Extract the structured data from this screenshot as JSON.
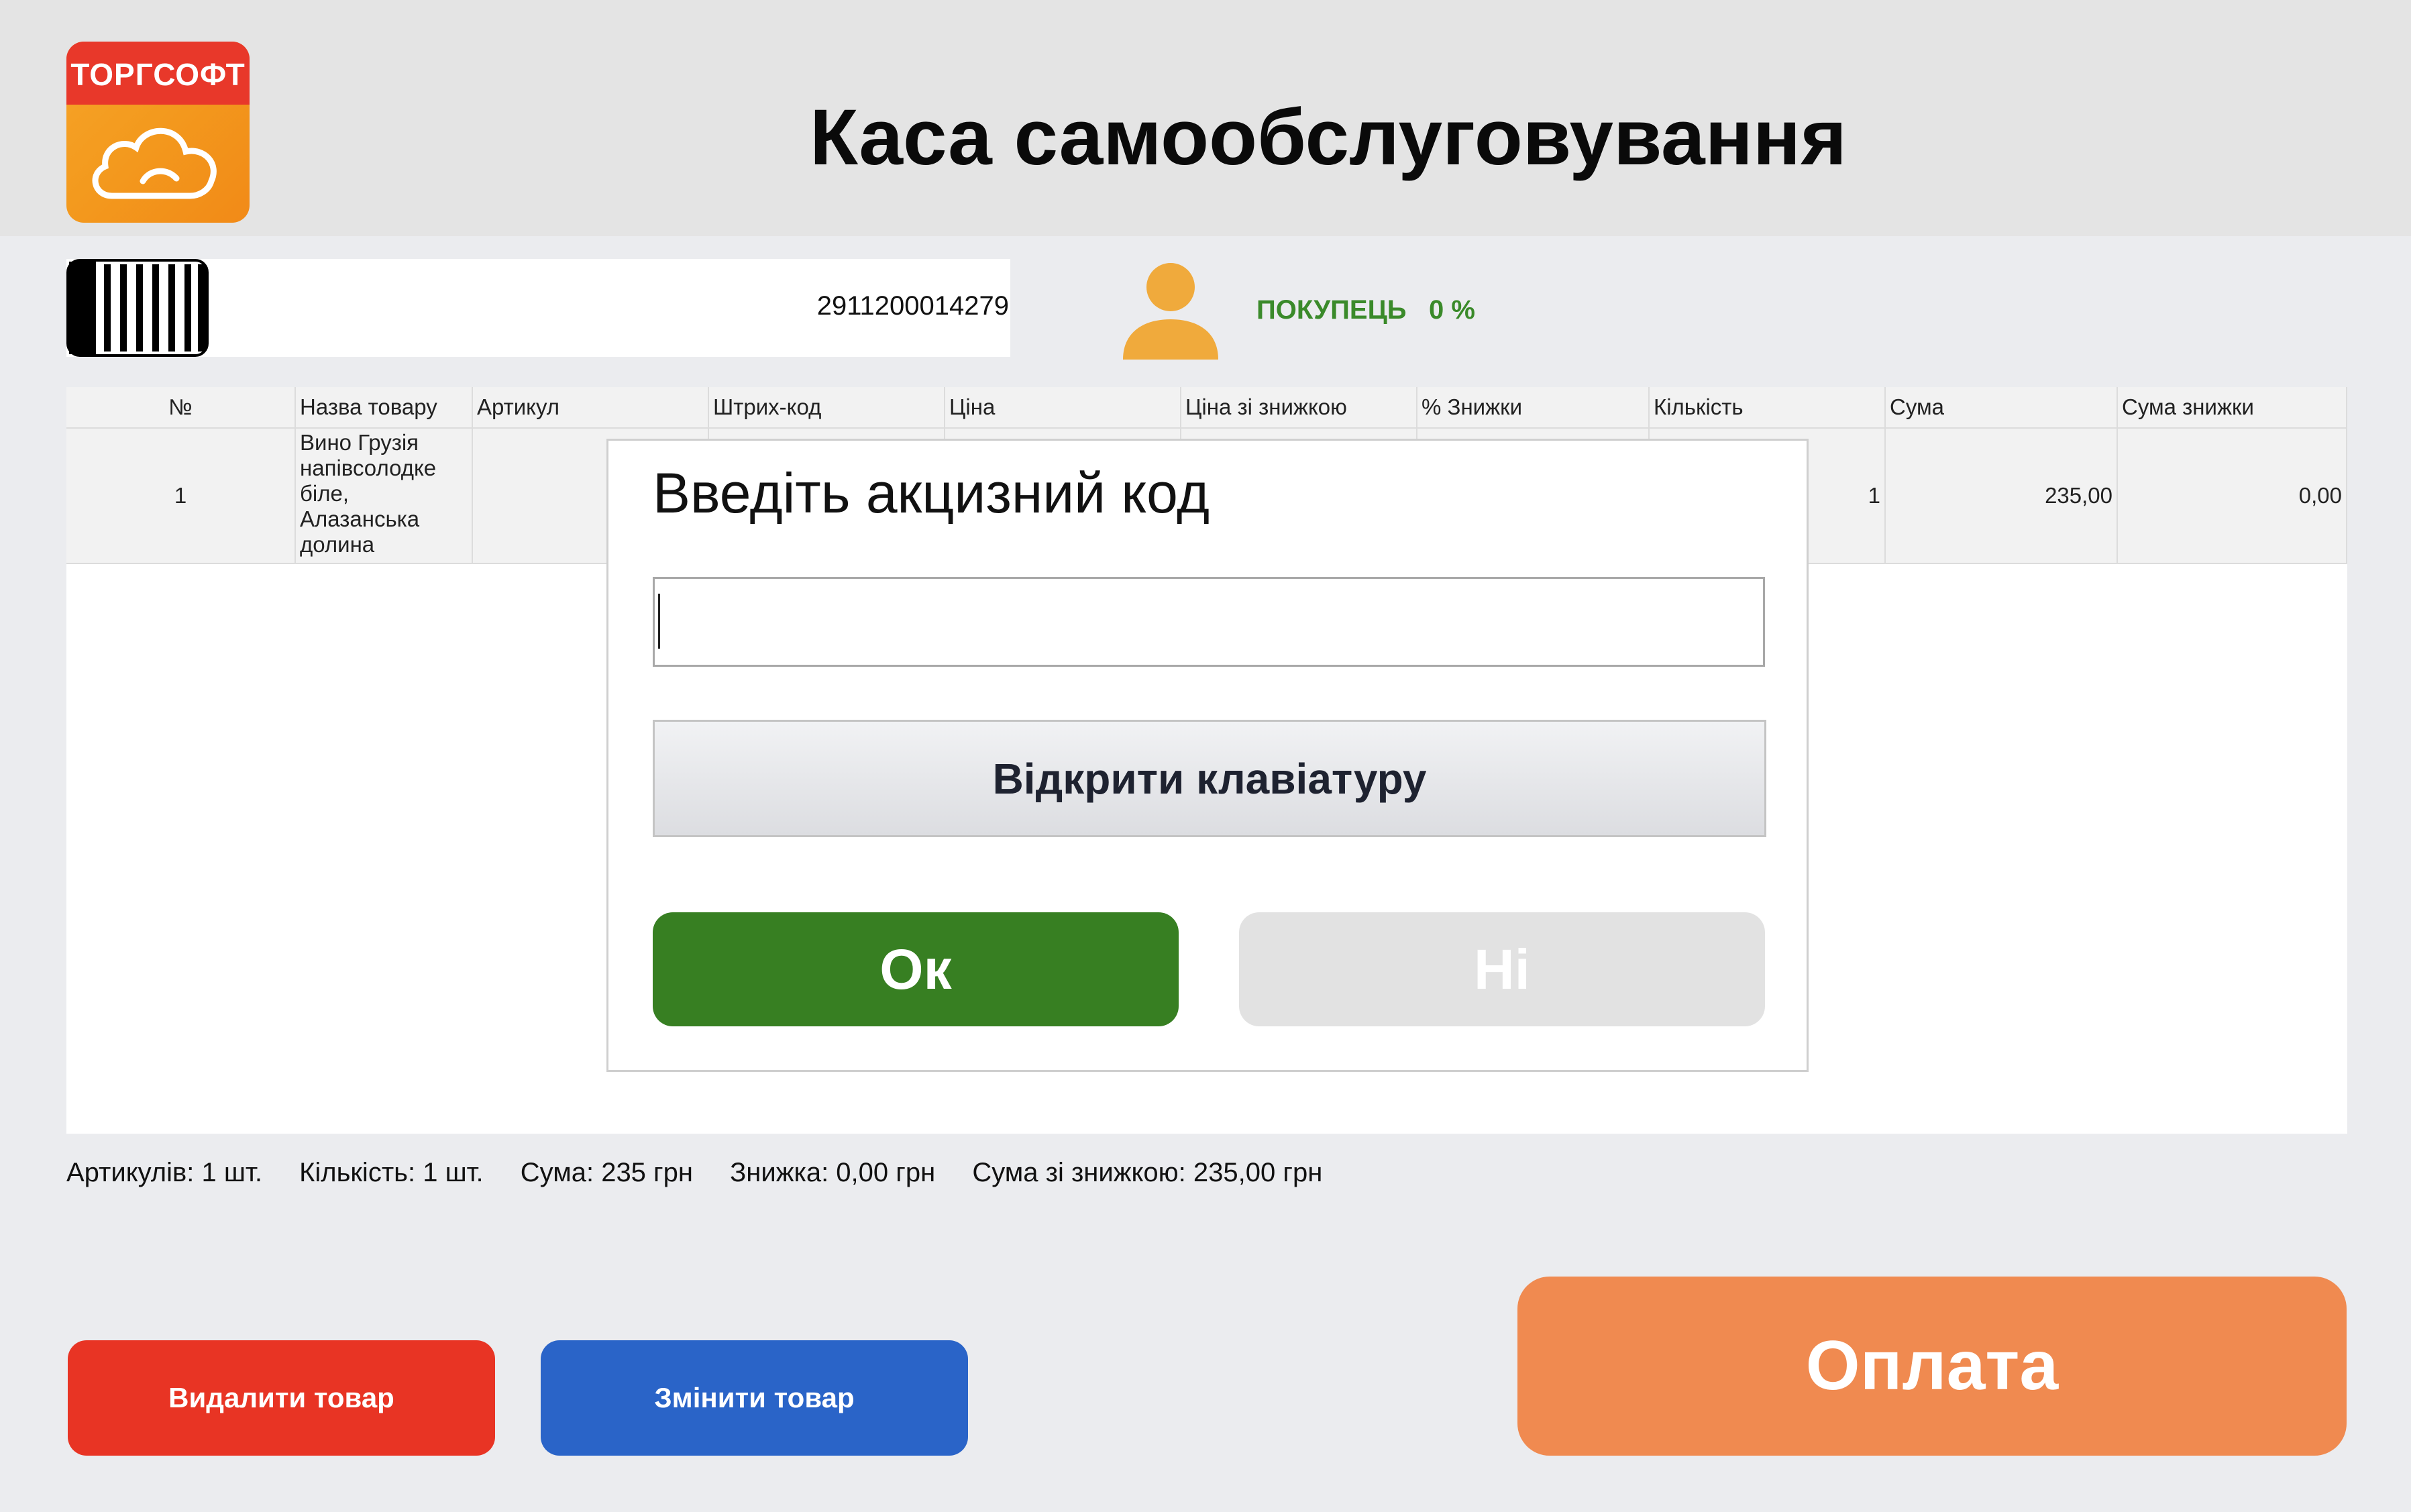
{
  "header": {
    "logo_text": "ТОРГСОФТ",
    "title": "Каса самообслуговування"
  },
  "scan": {
    "barcode_value": "2911200014279",
    "icon": "barcode-icon"
  },
  "customer": {
    "label": "ПОКУПЕЦЬ",
    "discount": "0 %",
    "icon": "user-icon",
    "color": "#3a8a2a"
  },
  "table": {
    "columns": [
      "№",
      "Назва товару",
      "Артикул",
      "Штрих-код",
      "Ціна",
      "Ціна зі знижкою",
      "% Знижки",
      "Кількість",
      "Сума",
      "Сума знижки"
    ],
    "rows": [
      {
        "num": "1",
        "name": "Вино Грузія напівсолодке біле, Алазанська долина",
        "article": "",
        "barcode": "",
        "price": "",
        "price_discount": "",
        "discount_pct": "",
        "qty": "1",
        "sum": "235,00",
        "discount_sum": "0,00"
      }
    ]
  },
  "summary": {
    "articles": "Артикулів: 1 шт.",
    "quantity": "Кількість: 1 шт.",
    "sum": "Сума: 235 грн",
    "discount": "Знижка: 0,00 грн",
    "sum_discount": "Сума зі знижкою: 235,00 грн"
  },
  "buttons": {
    "delete": "Видалити товар",
    "change": "Змінити товар",
    "pay": "Оплата"
  },
  "colors": {
    "delete": "#e83424",
    "change": "#2a64c8",
    "pay": "#f08a50",
    "ok": "#377f22",
    "no": "#e2e2e2",
    "logo_red": "#e8382a",
    "logo_orange": "#f39a1e"
  },
  "dialog": {
    "title": "Введіть акцизний код",
    "input_value": "",
    "keyboard_button": "Відкрити клавіатуру",
    "ok": "Ок",
    "no": "Ні"
  }
}
